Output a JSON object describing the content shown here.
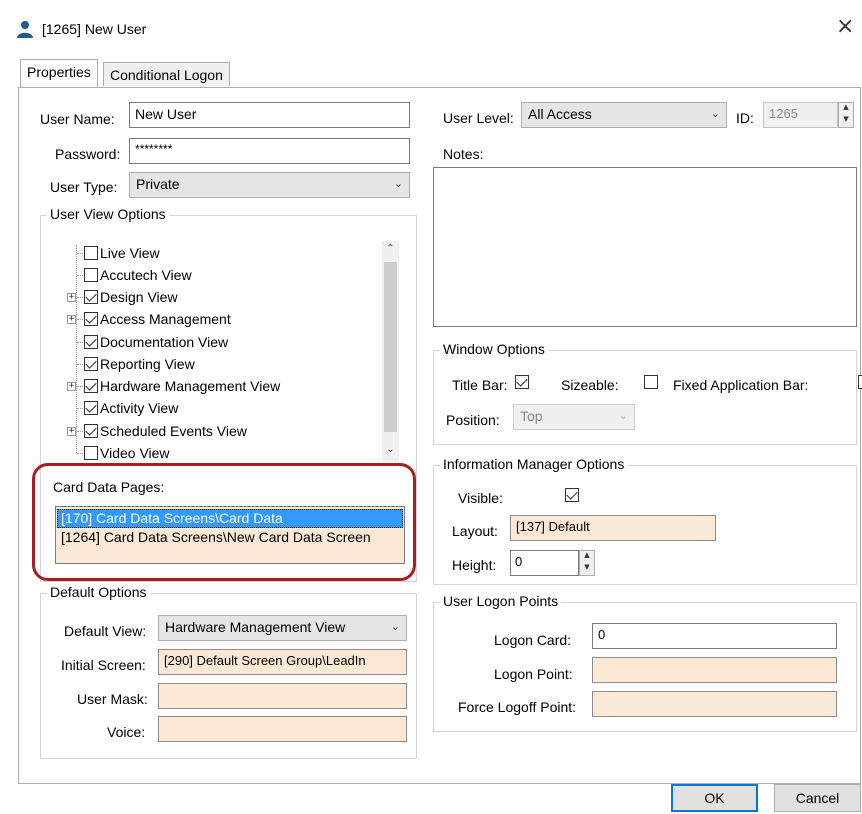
{
  "window": {
    "title": "[1265] New User",
    "close_glyph": "×"
  },
  "tabs": [
    {
      "label": "Properties",
      "active": true
    },
    {
      "label": "Conditional Logon",
      "active": false
    }
  ],
  "user": {
    "name_label": "User Name:",
    "name_value": "New User",
    "password_label": "Password:",
    "password_value": "********",
    "type_label": "User Type:",
    "type_value": "Private",
    "level_label": "User Level:",
    "level_value": "All Access",
    "id_label": "ID:",
    "id_value": "1265",
    "notes_label": "Notes:"
  },
  "user_view_options": {
    "title": "User View Options",
    "items": [
      {
        "label": "Live View",
        "checked": false,
        "expandable": false
      },
      {
        "label": "Accutech View",
        "checked": false,
        "expandable": false
      },
      {
        "label": "Design View",
        "checked": true,
        "expandable": true
      },
      {
        "label": "Access Management",
        "checked": true,
        "expandable": true
      },
      {
        "label": "Documentation View",
        "checked": true,
        "expandable": false
      },
      {
        "label": "Reporting View",
        "checked": true,
        "expandable": false
      },
      {
        "label": "Hardware Management View",
        "checked": true,
        "expandable": true
      },
      {
        "label": "Activity View",
        "checked": true,
        "expandable": false
      },
      {
        "label": "Scheduled Events View",
        "checked": true,
        "expandable": true
      },
      {
        "label": "Video View",
        "checked": false,
        "expandable": false
      }
    ]
  },
  "card_data": {
    "label": "Card Data Pages:",
    "items": [
      {
        "label": "[170] Card Data Screens\\Card Data",
        "selected": true
      },
      {
        "label": "[1264] Card Data Screens\\New Card Data Screen",
        "selected": false
      }
    ]
  },
  "default_options": {
    "title": "Default Options",
    "default_view_label": "Default View:",
    "default_view_value": "Hardware Management View",
    "initial_screen_label": "Initial Screen:",
    "initial_screen_value": "[290] Default Screen Group\\LeadIn",
    "user_mask_label": "User Mask:",
    "user_mask_value": "",
    "voice_label": "Voice:",
    "voice_value": ""
  },
  "window_options": {
    "title": "Window Options",
    "title_bar_label": "Title Bar:",
    "title_bar_checked": true,
    "sizeable_label": "Sizeable:",
    "sizeable_checked": false,
    "fixed_app_bar_label": "Fixed Application Bar:",
    "fixed_app_bar_checked": false,
    "position_label": "Position:",
    "position_value": "Top"
  },
  "info_manager": {
    "title": "Information Manager Options",
    "visible_label": "Visible:",
    "visible_checked": true,
    "layout_label": "Layout:",
    "layout_value": "[137] Default",
    "height_label": "Height:",
    "height_value": "0"
  },
  "logon_points": {
    "title": "User Logon Points",
    "logon_card_label": "Logon Card:",
    "logon_card_value": "0",
    "logon_point_label": "Logon Point:",
    "logon_point_value": "",
    "force_logoff_label": "Force Logoff Point:",
    "force_logoff_value": ""
  },
  "buttons": {
    "ok": "OK",
    "cancel": "Cancel"
  },
  "colors": {
    "highlight": "#a71e22",
    "selection": "#3399ff",
    "field_peach": "#fbe9d6",
    "default_button_border": "#0078d7"
  },
  "icons": {
    "window": "user-icon",
    "close": "close-icon",
    "dropdown": "chevron-down-icon",
    "expander": "plus-expander-icon",
    "scroll_up": "scroll-up-arrow-icon",
    "scroll_down": "scroll-down-arrow-icon",
    "spin_up": "spin-up-icon",
    "spin_down": "spin-down-icon"
  }
}
